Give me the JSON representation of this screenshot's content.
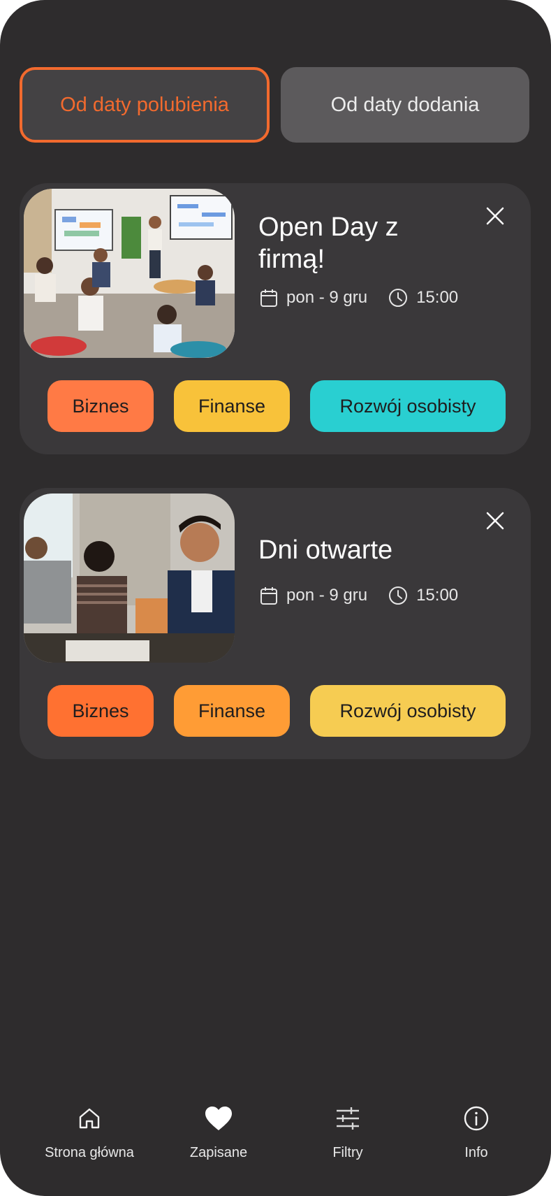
{
  "sort": {
    "active_label": "Od daty polubienia",
    "inactive_label": "Od daty dodania"
  },
  "colors": {
    "accent": "#f26a2e",
    "background": "#2e2c2d",
    "card": "#3a383a"
  },
  "events": [
    {
      "title_line1": "Open Day z",
      "title_line2": "firmą!",
      "date": "pon - 9 gru",
      "time": "15:00",
      "tags": [
        {
          "label": "Biznes",
          "color": "#ff7a45"
        },
        {
          "label": "Finanse",
          "color": "#f8c23a"
        },
        {
          "label": "Rozwój osobisty",
          "color": "#29cfd1"
        }
      ]
    },
    {
      "title_line1": "Dni otwarte",
      "date": "pon - 9 gru",
      "time": "15:00",
      "tags": [
        {
          "label": "Biznes",
          "color": "#ff7131"
        },
        {
          "label": "Finanse",
          "color": "#ff9c35"
        },
        {
          "label": "Rozwój osobisty",
          "color": "#f6cc52"
        }
      ]
    }
  ],
  "nav": {
    "home": "Strona główna",
    "saved": "Zapisane",
    "filters": "Filtry",
    "info": "Info"
  },
  "icons": {
    "date": "calendar-icon",
    "time": "clock-icon",
    "remove": "close-icon",
    "home": "home-icon",
    "saved": "heart-icon",
    "filters": "sliders-icon",
    "info": "info-icon"
  }
}
